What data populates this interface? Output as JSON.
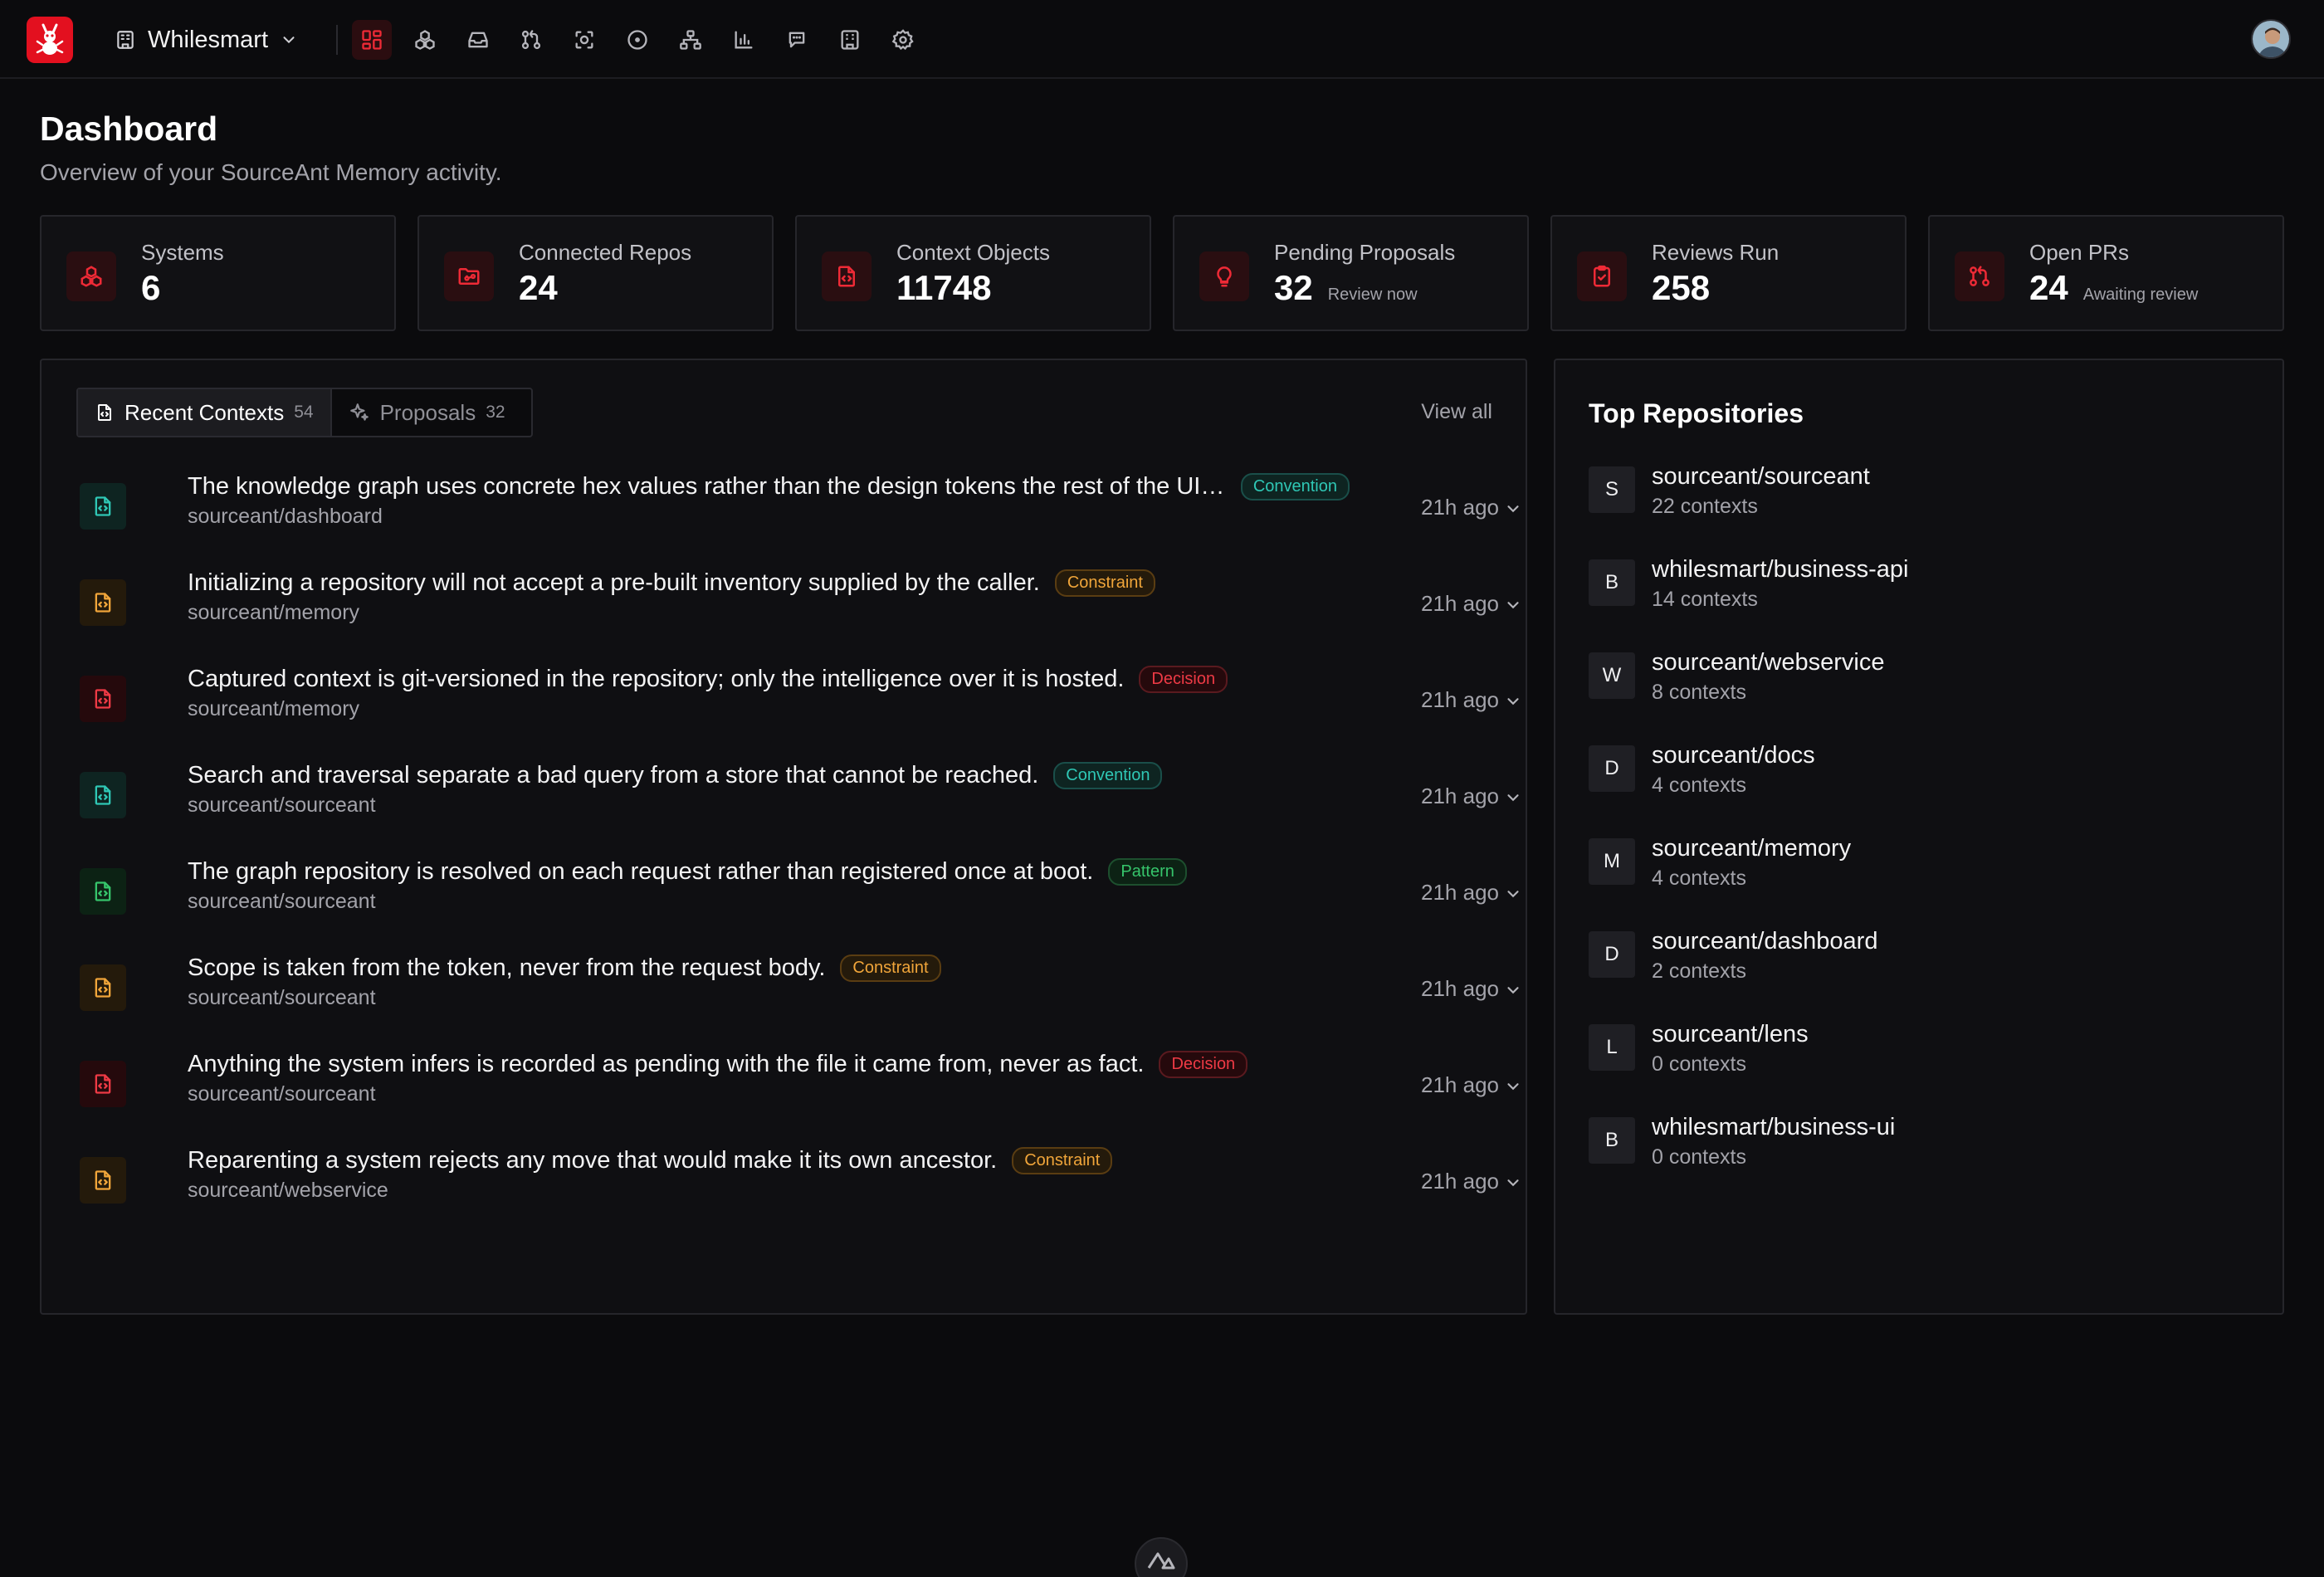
{
  "nav": {
    "org_name": "Whilesmart",
    "icons": [
      "dashboard-icon",
      "systems-icon",
      "inbox-icon",
      "pull-request-icon",
      "scan-icon",
      "issue-icon",
      "hierarchy-icon",
      "analytics-icon",
      "chat-icon",
      "building-icon",
      "settings-icon"
    ],
    "active_icon": "dashboard-icon"
  },
  "header": {
    "title": "Dashboard",
    "subtitle": "Overview of your SourceAnt Memory activity."
  },
  "stats": [
    {
      "label": "Systems",
      "value": "6",
      "note": "",
      "icon": "systems-icon"
    },
    {
      "label": "Connected Repos",
      "value": "24",
      "note": "",
      "icon": "folder-git-icon"
    },
    {
      "label": "Context Objects",
      "value": "11748",
      "note": "",
      "icon": "file-code-icon"
    },
    {
      "label": "Pending Proposals",
      "value": "32",
      "note": "Review now",
      "icon": "lightbulb-icon"
    },
    {
      "label": "Reviews Run",
      "value": "258",
      "note": "",
      "icon": "clipboard-check-icon"
    },
    {
      "label": "Open PRs",
      "value": "24",
      "note": "Awaiting review",
      "icon": "pull-request-icon"
    }
  ],
  "contexts_panel": {
    "tabs": [
      {
        "label": "Recent Contexts",
        "count": "54",
        "icon": "file-code-icon"
      },
      {
        "label": "Proposals",
        "count": "32",
        "icon": "sparkles-icon"
      }
    ],
    "view_all": "View all",
    "items": [
      {
        "title": "The knowledge graph uses concrete hex values rather than the design tokens the rest of the UI ...",
        "repo": "sourceant/dashboard",
        "badge": "Convention",
        "kind": "convention",
        "time": "21h ago"
      },
      {
        "title": "Initializing a repository will not accept a pre-built inventory supplied by the caller.",
        "repo": "sourceant/memory",
        "badge": "Constraint",
        "kind": "constraint",
        "time": "21h ago"
      },
      {
        "title": "Captured context is git-versioned in the repository; only the intelligence over it is hosted.",
        "repo": "sourceant/memory",
        "badge": "Decision",
        "kind": "decision",
        "time": "21h ago"
      },
      {
        "title": "Search and traversal separate a bad query from a store that cannot be reached.",
        "repo": "sourceant/sourceant",
        "badge": "Convention",
        "kind": "convention",
        "time": "21h ago"
      },
      {
        "title": "The graph repository is resolved on each request rather than registered once at boot.",
        "repo": "sourceant/sourceant",
        "badge": "Pattern",
        "kind": "pattern",
        "time": "21h ago"
      },
      {
        "title": "Scope is taken from the token, never from the request body.",
        "repo": "sourceant/sourceant",
        "badge": "Constraint",
        "kind": "constraint",
        "time": "21h ago"
      },
      {
        "title": "Anything the system infers is recorded as pending with the file it came from, never as fact.",
        "repo": "sourceant/sourceant",
        "badge": "Decision",
        "kind": "decision",
        "time": "21h ago"
      },
      {
        "title": "Reparenting a system rejects any move that would make it its own ancestor.",
        "repo": "sourceant/webservice",
        "badge": "Constraint",
        "kind": "constraint",
        "time": "21h ago"
      }
    ]
  },
  "repos_panel": {
    "title": "Top Repositories",
    "items": [
      {
        "initial": "S",
        "name": "sourceant/sourceant",
        "count": "22 contexts"
      },
      {
        "initial": "B",
        "name": "whilesmart/business-api",
        "count": "14 contexts"
      },
      {
        "initial": "W",
        "name": "sourceant/webservice",
        "count": "8 contexts"
      },
      {
        "initial": "D",
        "name": "sourceant/docs",
        "count": "4 contexts"
      },
      {
        "initial": "M",
        "name": "sourceant/memory",
        "count": "4 contexts"
      },
      {
        "initial": "D",
        "name": "sourceant/dashboard",
        "count": "2 contexts"
      },
      {
        "initial": "L",
        "name": "sourceant/lens",
        "count": "0 contexts"
      },
      {
        "initial": "B",
        "name": "whilesmart/business-ui",
        "count": "0 contexts"
      }
    ]
  },
  "colors": {
    "accent": "#e3101f",
    "background": "#0b0b0d",
    "convention": "#2fc7b5",
    "constraint": "#f0a53a",
    "decision": "#ee3a45",
    "pattern": "#36c46b"
  }
}
